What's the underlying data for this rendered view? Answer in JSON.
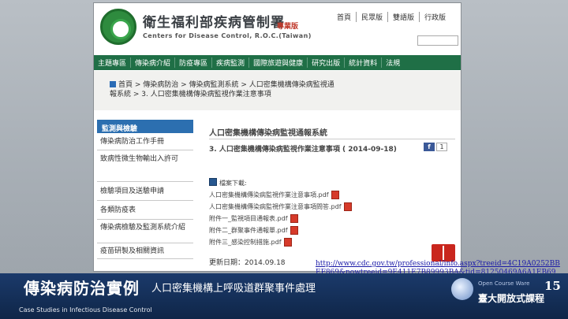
{
  "site": {
    "org_name": "衛生福利部疾病管制署",
    "org_tag": "專業版",
    "org_en": "Centers for Disease Control, R.O.C.(Taiwan)"
  },
  "top_links": [
    "首頁",
    "民眾版",
    "雙語版",
    "行政版"
  ],
  "nav": [
    "主題專區",
    "傳染病介紹",
    "防疫專區",
    "疾病監測",
    "國際旅遊與健康",
    "研究出版",
    "統計資料",
    "法規"
  ],
  "breadcrumb": "首頁 > 傳染病防治 > 傳染病監測系統 > 人口密集機構傳染病監視通報系統 > 3. 人口密集機構傳染病監視作業注意事項",
  "sidebar": {
    "header": "監測與檢驗",
    "items": [
      "傳染病防治工作手冊",
      "致病性微生物輸出入許可",
      "檢驗項目及送驗申請",
      "各類防疫表",
      "傳染病檢驗及監測系統介紹",
      "疫苗研製及相關資訊"
    ]
  },
  "main": {
    "section_title": "人口密集機構傳染病監視通報系統",
    "doc_title": "3. 人口密集機構傳染病監視作業注意事項 ( 2014-09-18)",
    "fb_label": "f",
    "fb_count": "1",
    "download_label": "檔案下載:",
    "files": [
      "人口密集機構傳染病監視作業注意事項.pdf",
      "人口密集機構傳染病監視作業注意事項問答.pdf",
      "附件一_監視項目通報表.pdf",
      "附件二_群聚事件通報單.pdf",
      "附件三_感染控制措施.pdf"
    ],
    "updated": "更新日期：2014.09.18"
  },
  "url": "http://www.cdc.gov.tw/professional/info.aspx?treeid=4C19A0252BBEF869&nowtreeid=9E411E7B89993BA&tid=81250469A6A1EB69",
  "footer": {
    "title": "傳染病防治實例",
    "subtitle": "人口密集機構上呼吸道群聚事件處理",
    "en": "Case Studies in Infectious Disease Control",
    "brand_top": "Open Course Ware",
    "brand_name": "臺大開放式課程",
    "page": "15"
  },
  "colors": {
    "nav_green": "#1f6f46",
    "sidebar_blue": "#2c6fb0",
    "footer_navy": "#1b3a6b",
    "link_blue": "#1a1aa8"
  },
  "icons": [
    "cdc-logo-icon",
    "home-icon",
    "facebook-icon",
    "document-icon",
    "pdf-icon",
    "book-icon",
    "ocw-logo-icon"
  ]
}
